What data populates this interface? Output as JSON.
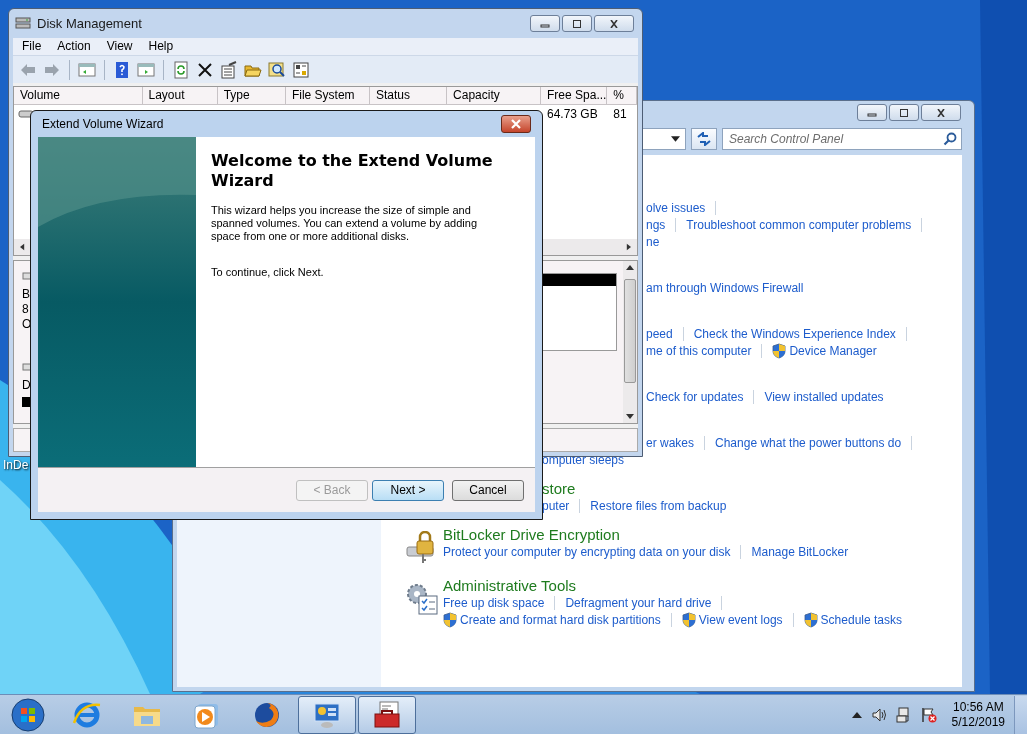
{
  "desktop_icon": {
    "label": "InDe"
  },
  "control_panel": {
    "search": {
      "placeholder": "Search Control Panel"
    },
    "categories": [
      {
        "kind": "plain",
        "lines": [
          {
            "kind": "covered",
            "links": [
              {
                "text": "olve issues",
                "shield": false,
                "separator": true
              }
            ]
          },
          {
            "kind": "covered",
            "links": [
              {
                "text": "ngs",
                "shield": false,
                "separator": true
              },
              {
                "text": "Troubleshoot common computer problems",
                "shield": false,
                "separator": true
              }
            ]
          },
          {
            "kind": "covered",
            "links": [
              {
                "text": "ne",
                "shield": false,
                "separator": false
              }
            ]
          }
        ]
      },
      {
        "kind": "plain",
        "lines": [
          {
            "kind": "covered",
            "links": [
              {
                "text": "am through Windows Firewall",
                "shield": false,
                "separator": false
              }
            ]
          }
        ]
      },
      {
        "kind": "plain",
        "lines": [
          {
            "kind": "covered",
            "links": [
              {
                "text": "peed",
                "shield": false,
                "separator": true
              },
              {
                "text": "Check the Windows Experience Index",
                "shield": false,
                "separator": true
              }
            ]
          },
          {
            "kind": "covered",
            "links": [
              {
                "text": "me of this computer",
                "shield": false,
                "separator": true
              },
              {
                "text": "Device Manager",
                "shield": true,
                "separator": false
              }
            ]
          }
        ]
      },
      {
        "kind": "plain",
        "lines": [
          {
            "kind": "covered",
            "links": [
              {
                "text": "Check for updates",
                "shield": false,
                "separator": true
              },
              {
                "text": "View installed updates",
                "shield": false,
                "separator": false
              }
            ]
          }
        ]
      },
      {
        "kind": "plain",
        "lines": [
          {
            "kind": "covered",
            "links": [
              {
                "text": "er wakes",
                "shield": false,
                "separator": true
              },
              {
                "text": "Change what the power buttons do",
                "shield": false,
                "separator": true
              }
            ]
          },
          {
            "kind": "partly-covered",
            "links": [
              {
                "text": "omputer sleeps",
                "shield": false,
                "separator": false
              }
            ]
          }
        ]
      },
      {
        "kind": "partly-covered",
        "heading": "store",
        "lines": [
          {
            "kind": "partly-covered",
            "links": [
              {
                "text": "puter",
                "shield": false,
                "separator": true
              },
              {
                "text": "Restore files from backup",
                "shield": false,
                "separator": false
              }
            ]
          }
        ]
      },
      {
        "kind": "lock",
        "heading": "BitLocker Drive Encryption",
        "lines": [
          {
            "kind": "full",
            "links": [
              {
                "text": "Protect your computer by encrypting data on your disk",
                "shield": false,
                "separator": true
              },
              {
                "text": "Manage BitLocker",
                "shield": false,
                "separator": false
              }
            ]
          }
        ]
      },
      {
        "kind": "tools",
        "heading": "Administrative Tools",
        "lines": [
          {
            "kind": "full",
            "links": [
              {
                "text": "Free up disk space",
                "shield": false,
                "separator": true
              },
              {
                "text": "Defragment your hard drive",
                "shield": false,
                "separator": true
              }
            ]
          },
          {
            "kind": "full",
            "links": [
              {
                "text": "Create and format hard disk partitions",
                "shield": true,
                "separator": true
              },
              {
                "text": "View event logs",
                "shield": true,
                "separator": true
              },
              {
                "text": "Schedule tasks",
                "shield": true,
                "separator": false
              }
            ]
          }
        ]
      }
    ]
  },
  "disk_management": {
    "title": "Disk Management",
    "menu": [
      "File",
      "Action",
      "View",
      "Help"
    ],
    "columns": [
      "Volume",
      "Layout",
      "Type",
      "File System",
      "Status",
      "Capacity",
      "Free Spa...",
      "%"
    ],
    "row": {
      "free_space": "64.73 GB",
      "percent_free": "81"
    },
    "disk_fragments": [
      "B",
      "8",
      "O",
      "D"
    ]
  },
  "wizard": {
    "title": "Extend Volume Wizard",
    "heading": "Welcome to the Extend Volume Wizard",
    "body": "This wizard helps you increase the size of simple and spanned volumes. You can extend a volume  by adding space from one or more additional disks.",
    "continue": "To continue, click Next.",
    "buttons": [
      {
        "label": "< Back",
        "disabled": true,
        "default": false
      },
      {
        "label": "Next >",
        "disabled": false,
        "default": true
      },
      {
        "label": "Cancel",
        "disabled": false,
        "default": false
      }
    ]
  },
  "taskbar": {
    "apps": [
      {
        "kind": "ie",
        "active": false
      },
      {
        "kind": "explorer",
        "active": false
      },
      {
        "kind": "media",
        "active": false
      },
      {
        "kind": "firefox",
        "active": false
      },
      {
        "kind": "control-panel",
        "active": true
      },
      {
        "kind": "toolbox",
        "active": true
      }
    ],
    "time": "10:56 AM",
    "date": "5/12/2019"
  }
}
